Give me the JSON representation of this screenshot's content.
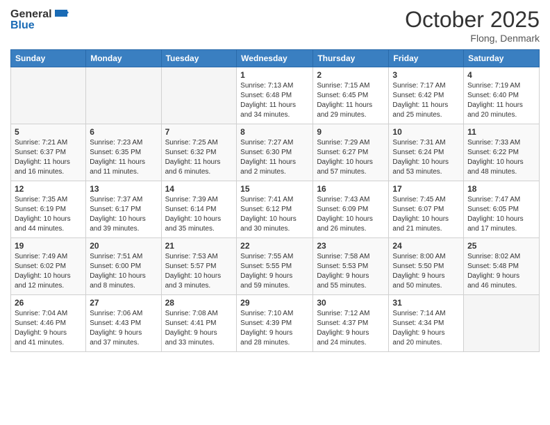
{
  "header": {
    "logo_general": "General",
    "logo_blue": "Blue",
    "title": "October 2025",
    "location": "Flong, Denmark"
  },
  "columns": [
    "Sunday",
    "Monday",
    "Tuesday",
    "Wednesday",
    "Thursday",
    "Friday",
    "Saturday"
  ],
  "weeks": [
    [
      {
        "day": "",
        "info": ""
      },
      {
        "day": "",
        "info": ""
      },
      {
        "day": "",
        "info": ""
      },
      {
        "day": "1",
        "info": "Sunrise: 7:13 AM\nSunset: 6:48 PM\nDaylight: 11 hours\nand 34 minutes."
      },
      {
        "day": "2",
        "info": "Sunrise: 7:15 AM\nSunset: 6:45 PM\nDaylight: 11 hours\nand 29 minutes."
      },
      {
        "day": "3",
        "info": "Sunrise: 7:17 AM\nSunset: 6:42 PM\nDaylight: 11 hours\nand 25 minutes."
      },
      {
        "day": "4",
        "info": "Sunrise: 7:19 AM\nSunset: 6:40 PM\nDaylight: 11 hours\nand 20 minutes."
      }
    ],
    [
      {
        "day": "5",
        "info": "Sunrise: 7:21 AM\nSunset: 6:37 PM\nDaylight: 11 hours\nand 16 minutes."
      },
      {
        "day": "6",
        "info": "Sunrise: 7:23 AM\nSunset: 6:35 PM\nDaylight: 11 hours\nand 11 minutes."
      },
      {
        "day": "7",
        "info": "Sunrise: 7:25 AM\nSunset: 6:32 PM\nDaylight: 11 hours\nand 6 minutes."
      },
      {
        "day": "8",
        "info": "Sunrise: 7:27 AM\nSunset: 6:30 PM\nDaylight: 11 hours\nand 2 minutes."
      },
      {
        "day": "9",
        "info": "Sunrise: 7:29 AM\nSunset: 6:27 PM\nDaylight: 10 hours\nand 57 minutes."
      },
      {
        "day": "10",
        "info": "Sunrise: 7:31 AM\nSunset: 6:24 PM\nDaylight: 10 hours\nand 53 minutes."
      },
      {
        "day": "11",
        "info": "Sunrise: 7:33 AM\nSunset: 6:22 PM\nDaylight: 10 hours\nand 48 minutes."
      }
    ],
    [
      {
        "day": "12",
        "info": "Sunrise: 7:35 AM\nSunset: 6:19 PM\nDaylight: 10 hours\nand 44 minutes."
      },
      {
        "day": "13",
        "info": "Sunrise: 7:37 AM\nSunset: 6:17 PM\nDaylight: 10 hours\nand 39 minutes."
      },
      {
        "day": "14",
        "info": "Sunrise: 7:39 AM\nSunset: 6:14 PM\nDaylight: 10 hours\nand 35 minutes."
      },
      {
        "day": "15",
        "info": "Sunrise: 7:41 AM\nSunset: 6:12 PM\nDaylight: 10 hours\nand 30 minutes."
      },
      {
        "day": "16",
        "info": "Sunrise: 7:43 AM\nSunset: 6:09 PM\nDaylight: 10 hours\nand 26 minutes."
      },
      {
        "day": "17",
        "info": "Sunrise: 7:45 AM\nSunset: 6:07 PM\nDaylight: 10 hours\nand 21 minutes."
      },
      {
        "day": "18",
        "info": "Sunrise: 7:47 AM\nSunset: 6:05 PM\nDaylight: 10 hours\nand 17 minutes."
      }
    ],
    [
      {
        "day": "19",
        "info": "Sunrise: 7:49 AM\nSunset: 6:02 PM\nDaylight: 10 hours\nand 12 minutes."
      },
      {
        "day": "20",
        "info": "Sunrise: 7:51 AM\nSunset: 6:00 PM\nDaylight: 10 hours\nand 8 minutes."
      },
      {
        "day": "21",
        "info": "Sunrise: 7:53 AM\nSunset: 5:57 PM\nDaylight: 10 hours\nand 3 minutes."
      },
      {
        "day": "22",
        "info": "Sunrise: 7:55 AM\nSunset: 5:55 PM\nDaylight: 9 hours\nand 59 minutes."
      },
      {
        "day": "23",
        "info": "Sunrise: 7:58 AM\nSunset: 5:53 PM\nDaylight: 9 hours\nand 55 minutes."
      },
      {
        "day": "24",
        "info": "Sunrise: 8:00 AM\nSunset: 5:50 PM\nDaylight: 9 hours\nand 50 minutes."
      },
      {
        "day": "25",
        "info": "Sunrise: 8:02 AM\nSunset: 5:48 PM\nDaylight: 9 hours\nand 46 minutes."
      }
    ],
    [
      {
        "day": "26",
        "info": "Sunrise: 7:04 AM\nSunset: 4:46 PM\nDaylight: 9 hours\nand 41 minutes."
      },
      {
        "day": "27",
        "info": "Sunrise: 7:06 AM\nSunset: 4:43 PM\nDaylight: 9 hours\nand 37 minutes."
      },
      {
        "day": "28",
        "info": "Sunrise: 7:08 AM\nSunset: 4:41 PM\nDaylight: 9 hours\nand 33 minutes."
      },
      {
        "day": "29",
        "info": "Sunrise: 7:10 AM\nSunset: 4:39 PM\nDaylight: 9 hours\nand 28 minutes."
      },
      {
        "day": "30",
        "info": "Sunrise: 7:12 AM\nSunset: 4:37 PM\nDaylight: 9 hours\nand 24 minutes."
      },
      {
        "day": "31",
        "info": "Sunrise: 7:14 AM\nSunset: 4:34 PM\nDaylight: 9 hours\nand 20 minutes."
      },
      {
        "day": "",
        "info": ""
      }
    ]
  ]
}
